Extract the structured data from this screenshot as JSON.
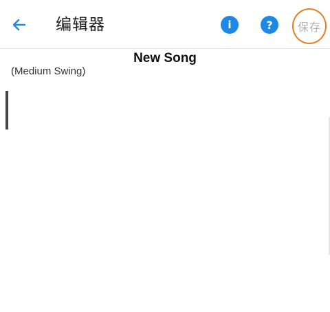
{
  "toolbar": {
    "title": "编辑器",
    "back_icon": "arrow-left-icon",
    "info_icon": "info-icon",
    "help_icon": "help-icon",
    "info_glyph": "i",
    "help_glyph": "?",
    "save_label": "保存",
    "accent_color": "#1e88e5",
    "highlight_color": "#e67e22"
  },
  "song": {
    "title": "New Song",
    "style": "(Medium Swing)"
  }
}
